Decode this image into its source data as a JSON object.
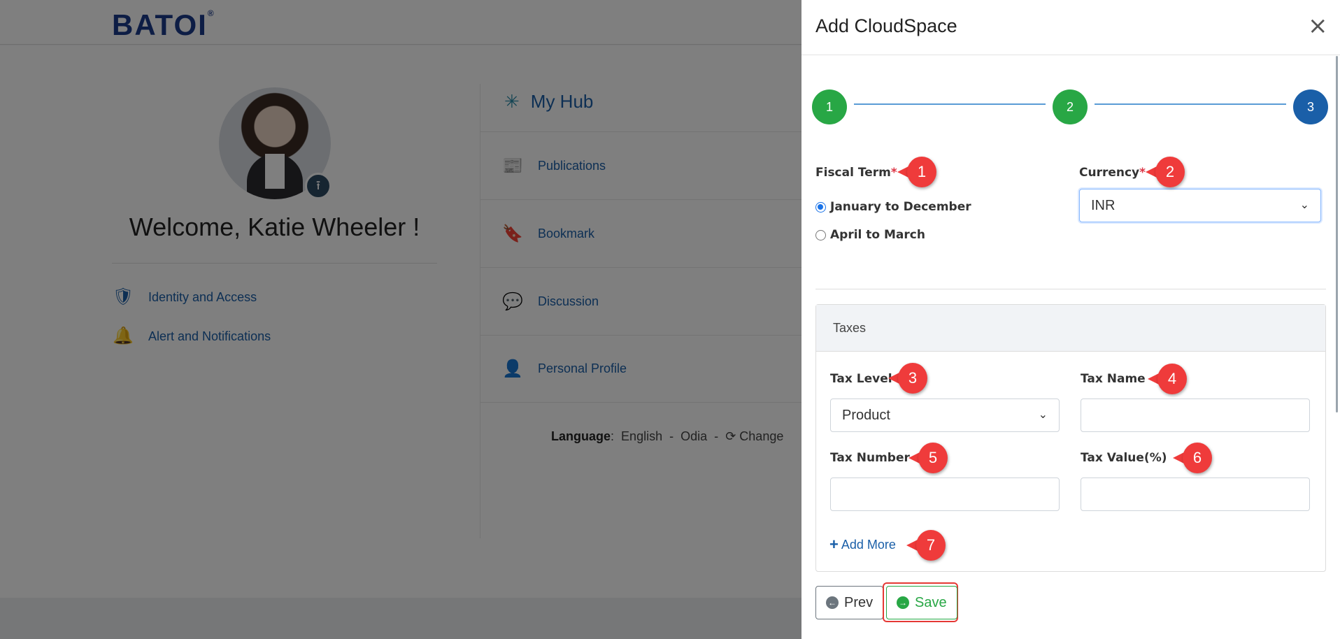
{
  "app": {
    "logo_text": "BATOI"
  },
  "profile": {
    "welcome": "Welcome, Katie Wheeler !"
  },
  "left_links": [
    {
      "label": "Identity and Access",
      "icon": "fingerprint-shield-icon"
    },
    {
      "label": "Alert and Notifications",
      "icon": "bell-icon"
    }
  ],
  "hub": {
    "title": "My Hub",
    "items": [
      {
        "label": "Publications",
        "icon": "newspaper-icon"
      },
      {
        "label": "Bookmark",
        "icon": "bookmark-icon"
      },
      {
        "label": "Discussion",
        "icon": "discussion-icon"
      },
      {
        "label": "Personal Profile",
        "icon": "user-icon"
      }
    ]
  },
  "language": {
    "label": "Language",
    "separator": ":",
    "options": [
      "English",
      "Odia"
    ],
    "dash": "-",
    "change": "Change"
  },
  "modal": {
    "title": "Add CloudSpace",
    "close": "×",
    "steps": [
      "1",
      "2",
      "3"
    ],
    "fiscal_term": {
      "label": "Fiscal Term",
      "required": "*",
      "options": [
        {
          "label": "January to December",
          "checked": true
        },
        {
          "label": "April to March",
          "checked": false
        }
      ]
    },
    "currency": {
      "label": "Currency",
      "required": "*",
      "value": "INR"
    },
    "taxes": {
      "heading": "Taxes",
      "tax_level": {
        "label": "Tax Level",
        "value": "Product"
      },
      "tax_name": {
        "label": "Tax Name",
        "value": ""
      },
      "tax_number": {
        "label": "Tax Number",
        "value": ""
      },
      "tax_value": {
        "label": "Tax Value(%)",
        "value": ""
      },
      "add_more": "Add More"
    },
    "buttons": {
      "prev": "Prev",
      "save": "Save"
    }
  },
  "annotations": [
    "1",
    "2",
    "3",
    "4",
    "5",
    "6",
    "7"
  ],
  "colors": {
    "primary": "#1a5fa8",
    "success": "#28a745",
    "required": "#dc3545",
    "annotation": "#ef3b3b"
  }
}
